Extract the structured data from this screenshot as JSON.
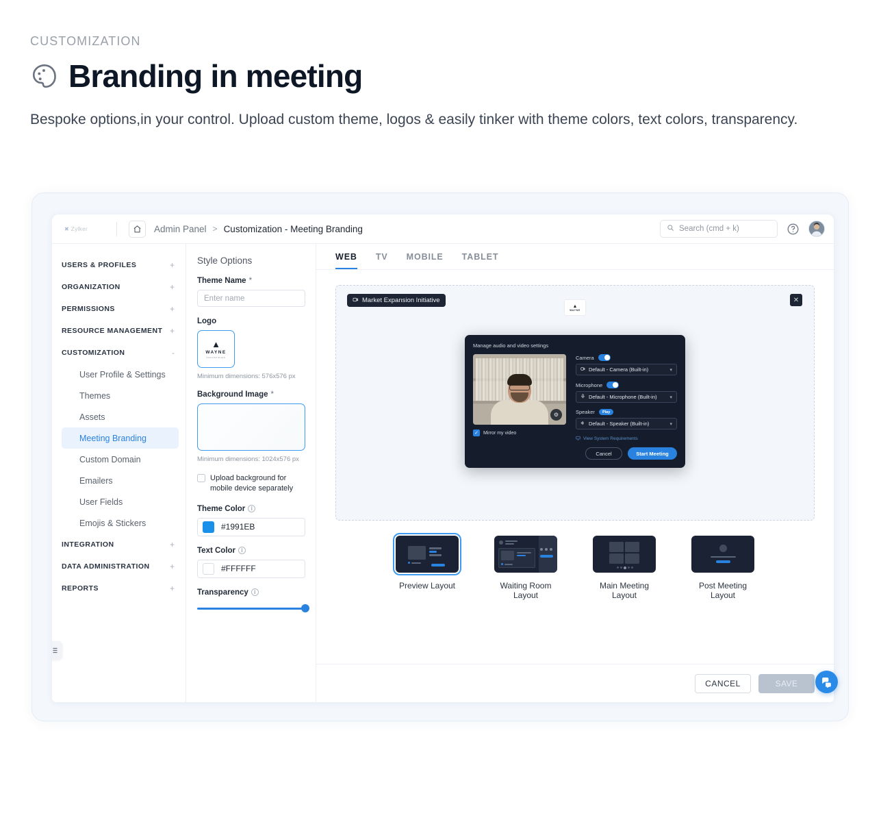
{
  "hero": {
    "eyebrow": "CUSTOMIZATION",
    "title": "Branding in meeting",
    "icon": "palette-icon",
    "subtitle": "Bespoke options,in your control. Upload custom theme, logos & easily tinker with theme colors, text colors, transparency."
  },
  "topbar": {
    "brand": "Zylker",
    "home_icon": "home-icon",
    "breadcrumb_root": "Admin Panel",
    "breadcrumb_sep": ">",
    "breadcrumb_current": "Customization - Meeting Branding",
    "search_placeholder": "Search (cmd + k)",
    "search_icon": "search-icon",
    "help_icon": "help-circle-icon",
    "avatar": "user-avatar"
  },
  "sidebar": {
    "groups": [
      {
        "label": "USERS & PROFILES",
        "toggle": "+"
      },
      {
        "label": "ORGANIZATION",
        "toggle": "+"
      },
      {
        "label": "PERMISSIONS",
        "toggle": "+"
      },
      {
        "label": "RESOURCE MANAGEMENT",
        "toggle": "+"
      },
      {
        "label": "CUSTOMIZATION",
        "toggle": "-"
      }
    ],
    "customization_items": [
      {
        "label": "User Profile & Settings",
        "active": false
      },
      {
        "label": "Themes",
        "active": false
      },
      {
        "label": "Assets",
        "active": false
      },
      {
        "label": "Meeting Branding",
        "active": true
      },
      {
        "label": "Custom Domain",
        "active": false
      },
      {
        "label": "Emailers",
        "active": false
      },
      {
        "label": "User Fields",
        "active": false
      },
      {
        "label": "Emojis & Stickers",
        "active": false
      }
    ],
    "groups_tail": [
      {
        "label": "INTEGRATION",
        "toggle": "+"
      },
      {
        "label": "DATA ADMINISTRATION",
        "toggle": "+"
      },
      {
        "label": "REPORTS",
        "toggle": "+"
      }
    ],
    "collapse_icon": "collapse-sidebar-icon"
  },
  "style_panel": {
    "title": "Style Options",
    "theme_name_label": "Theme Name",
    "required_mark": "*",
    "theme_name_placeholder": "Enter name",
    "theme_name_value": "",
    "logo_label": "Logo",
    "logo_brand": "WAYNE",
    "logo_brand_sub": "INDUSTRIES",
    "logo_hint": "Minimum dimensions: 576x576 px",
    "background_label": "Background Image",
    "background_hint": "Minimum dimensions: 1024x576 px",
    "mobile_checkbox_label": "Upload background for mobile device separately",
    "mobile_checkbox_checked": false,
    "theme_color_label": "Theme Color",
    "theme_color_value": "#1991EB",
    "text_color_label": "Text Color",
    "text_color_value": "#FFFFFF",
    "transparency_label": "Transparency",
    "transparency_percent": 100,
    "info_icon": "info-icon"
  },
  "tabs": [
    {
      "label": "WEB",
      "active": true
    },
    {
      "label": "TV",
      "active": false
    },
    {
      "label": "MOBILE",
      "active": false
    },
    {
      "label": "TABLET",
      "active": false
    }
  ],
  "stage": {
    "meeting_chip": "Market Expansion Initiative",
    "chip_icon": "video-camera-icon",
    "close_icon": "close-icon",
    "logo_brand": "WAYNE",
    "logo_brand_sub": "INDUSTRIES"
  },
  "dialog": {
    "title": "Manage audio and video settings",
    "mirror_label": "Mirror my video",
    "mirror_checked": true,
    "controls": [
      {
        "name": "Camera",
        "toggle": true,
        "badge": "",
        "icon": "camera-icon",
        "value": "Default - Camera (Built-in)"
      },
      {
        "name": "Microphone",
        "toggle": true,
        "badge": "",
        "icon": "microphone-icon",
        "value": "Default - Microphone (Built-in)"
      },
      {
        "name": "Speaker",
        "toggle": false,
        "badge": "Play",
        "icon": "speaker-icon",
        "value": "Default - Speaker (Built-in)"
      }
    ],
    "system_req_label": "View System Requirements",
    "system_req_icon": "monitor-icon",
    "cancel_label": "Cancel",
    "start_label": "Start Meeting"
  },
  "layouts": [
    {
      "label": "Preview Layout",
      "selected": true
    },
    {
      "label": "Waiting Room Layout",
      "selected": false
    },
    {
      "label": "Main Meeting Layout",
      "selected": false
    },
    {
      "label": "Post Meeting Layout",
      "selected": false
    }
  ],
  "footer": {
    "cancel_label": "CANCEL",
    "save_label": "SAVE",
    "chat_icon": "chat-bubble-icon"
  },
  "colors": {
    "accent": "#2a82e0",
    "theme": "#1991EB",
    "text_color": "#FFFFFF",
    "dark_panel": "#151d2c"
  }
}
